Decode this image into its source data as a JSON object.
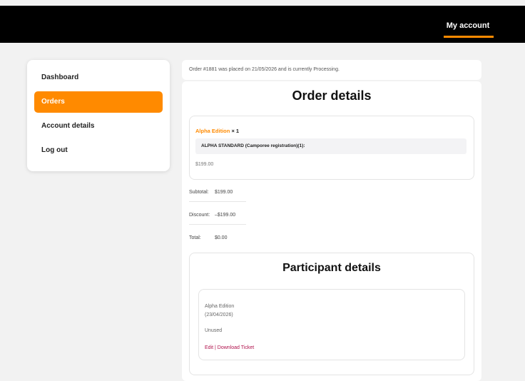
{
  "header": {
    "nav_label": "My account"
  },
  "sidebar": {
    "items": [
      {
        "label": "Dashboard"
      },
      {
        "label": "Orders",
        "active": true
      },
      {
        "label": "Account details"
      },
      {
        "label": "Log out"
      }
    ]
  },
  "notice": "Order #1881 was placed on 21/05/2026 and is currently Processing.",
  "order": {
    "title": "Order details",
    "item": {
      "product": "Alpha Edition",
      "qty": "× 1",
      "meta": "ALPHA STANDARD (Camporee registration)(1):",
      "price": "$199.00"
    },
    "totals": [
      {
        "label": "Subtotal:",
        "value": "$199.00"
      },
      {
        "label": "Discount:",
        "value": "–$199.00"
      },
      {
        "label": "Total:",
        "value": "$0.00"
      }
    ]
  },
  "participants": {
    "title": "Participant details",
    "name": "Alpha Edition",
    "date": "(23/04/2026)",
    "status": "Unused",
    "edit_label": "Edit",
    "separator": "|",
    "download_label": "Download Ticket"
  },
  "colors": {
    "accent": "#ff8a00",
    "link": "#b0124c",
    "header_bg": "#000000"
  }
}
